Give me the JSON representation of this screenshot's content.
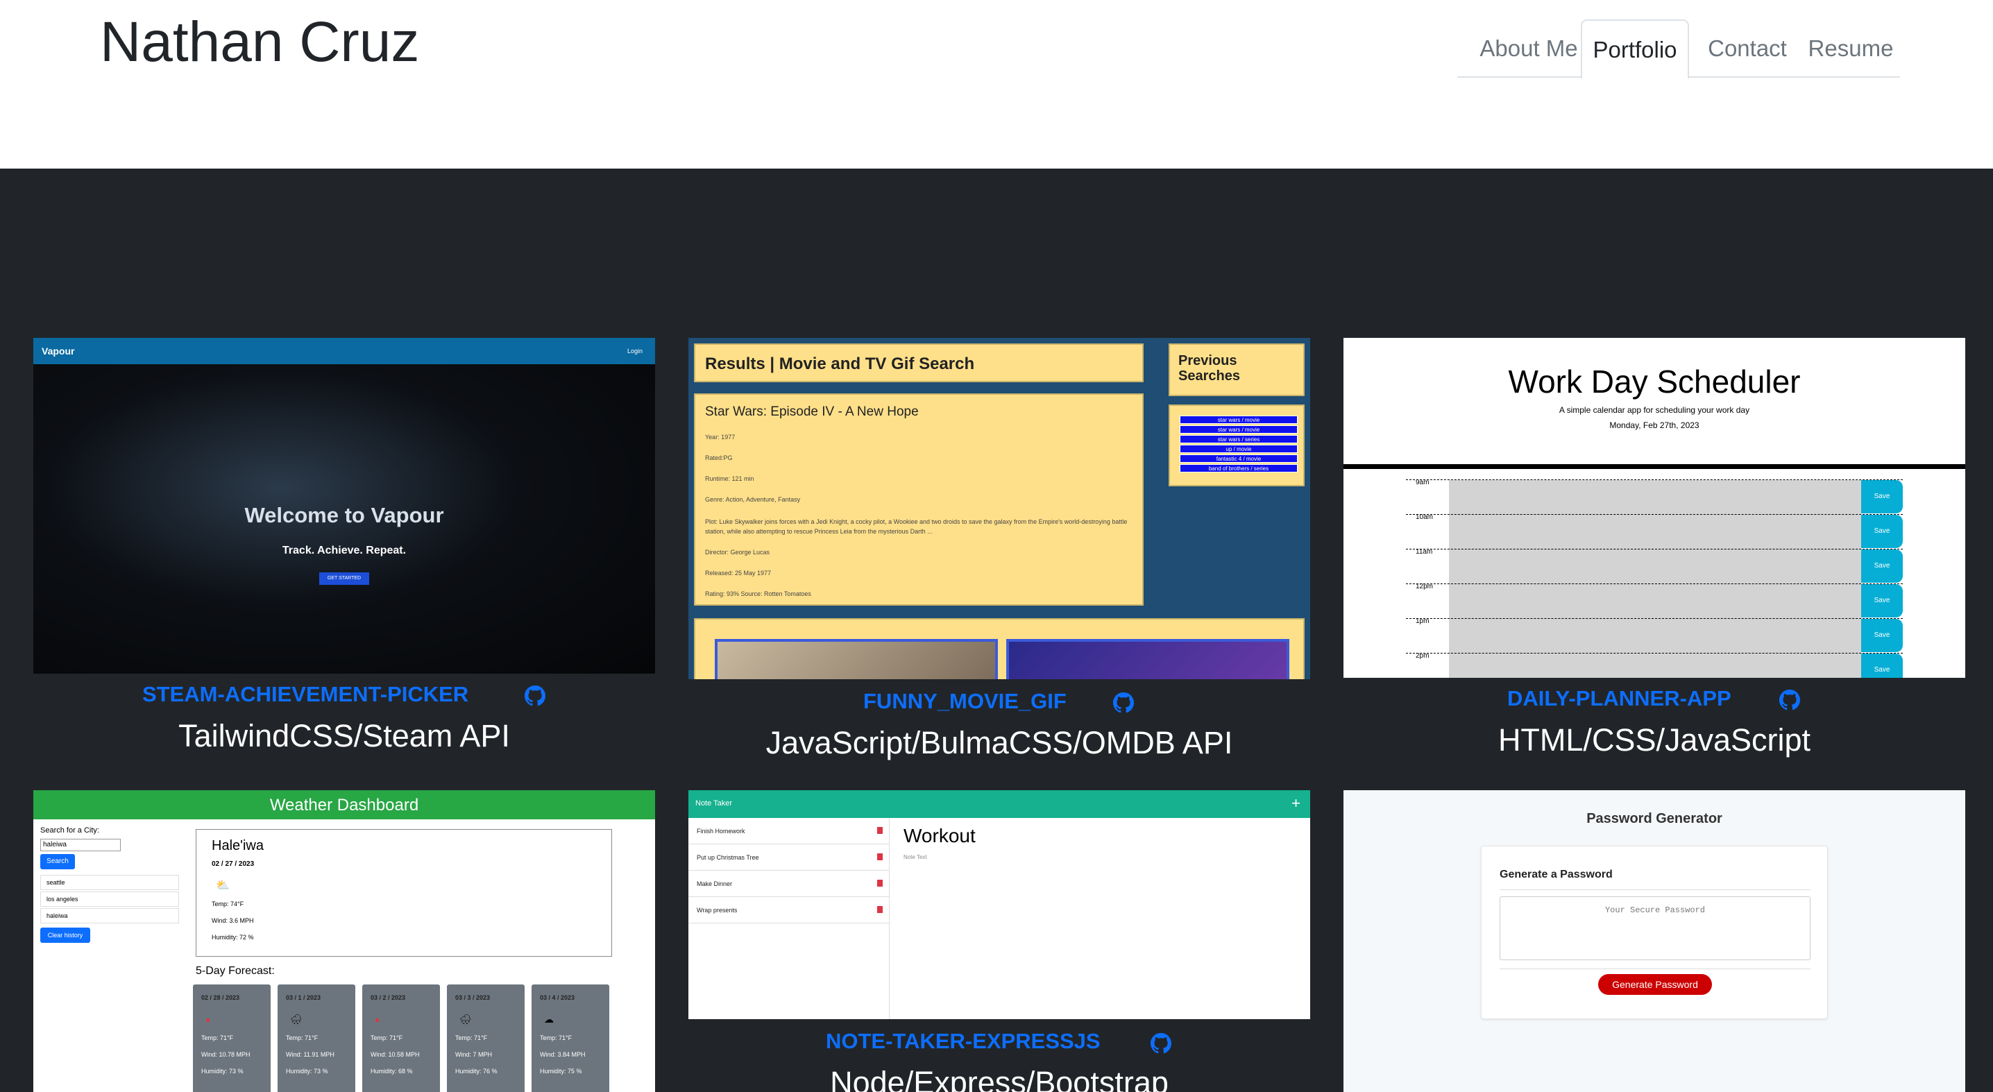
{
  "header": {
    "title": "Nathan Cruz"
  },
  "nav": [
    {
      "label": "About Me",
      "active": false
    },
    {
      "label": "Portfolio",
      "active": true
    },
    {
      "label": "Contact",
      "active": false
    },
    {
      "label": "Resume",
      "active": false
    }
  ],
  "projects": [
    {
      "name": "STEAM-ACHIEVEMENT-PICKER",
      "tech": "TailwindCSS/Steam API"
    },
    {
      "name": "FUNNY_MOVIE_GIF",
      "tech": "JavaScript/BulmaCSS/OMDB API"
    },
    {
      "name": "DAILY-PLANNER-APP",
      "tech": "HTML/CSS/JavaScript"
    },
    {
      "name": "NOTE-TAKER-EXPRESSJS",
      "tech": "Node/Express/Bootstrap"
    }
  ],
  "vapour": {
    "brand": "Vapour",
    "login": "Login",
    "welcome": "Welcome to Vapour",
    "tagline": "Track. Achieve. Repeat.",
    "cta": "GET STARTED"
  },
  "movie": {
    "title": "Results | Movie and TV Gif Search",
    "prev": "Previous Searches",
    "film": "Star Wars: Episode IV - A New Hope",
    "details": [
      "Year: 1977",
      "Rated:PG",
      "Runtime: 121 min",
      "Genre: Action, Adventure, Fantasy",
      "Plot: Luke Skywalker joins forces with a Jedi Knight, a cocky pilot, a Wookiee and two droids to save the galaxy from the Empire's world-destroying battle station, while also attempting to rescue Princess Leia from the mysterious Darth ...",
      "Director: George Lucas",
      "Released: 25 May 1977",
      "Rating: 93% Source: Rotten Tomatoes"
    ],
    "history": [
      "star wars / movie",
      "star wars / movie",
      "star wars / series",
      "up / movie",
      "fantastic 4 / movie",
      "band of brothers / series"
    ]
  },
  "planner": {
    "title": "Work Day Scheduler",
    "subtitle": "A simple calendar app for scheduling your work day",
    "date": "Monday, Feb 27th, 2023",
    "hours": [
      "9am",
      "10am",
      "11am",
      "12pm",
      "1pm",
      "2pm"
    ],
    "save": "Save"
  },
  "weather": {
    "title": "Weather Dashboard",
    "search_label": "Search for a City:",
    "search_value": "haleiwa",
    "search_btn": "Search",
    "history": [
      "seattle",
      "los angeles",
      "haleiwa"
    ],
    "clear": "Clear history",
    "city": "Hale'iwa",
    "date": "02 / 27 / 2023",
    "temp": "Temp: 74°F",
    "wind": "Wind: 3.6 MPH",
    "humidity": "Humidity: 72 %",
    "forecast_label": "5-Day Forecast:",
    "forecast": [
      {
        "date": "02 / 28 / 2023",
        "temp": "Temp: 71°F",
        "wind": "Wind: 10.78 MPH",
        "hum": "Humidity: 73 %"
      },
      {
        "date": "03 / 1 / 2023",
        "temp": "Temp: 71°F",
        "wind": "Wind: 11.91 MPH",
        "hum": "Humidity: 73 %"
      },
      {
        "date": "03 / 2 / 2023",
        "temp": "Temp: 71°F",
        "wind": "Wind: 10.58 MPH",
        "hum": "Humidity: 68 %"
      },
      {
        "date": "03 / 3 / 2023",
        "temp": "Temp: 71°F",
        "wind": "Wind: 7 MPH",
        "hum": "Humidity: 76 %"
      },
      {
        "date": "03 / 4 / 2023",
        "temp": "Temp: 71°F",
        "wind": "Wind: 3.84 MPH",
        "hum": "Humidity: 75 %"
      }
    ]
  },
  "notes": {
    "title": "Note Taker",
    "items": [
      "Finish Homework",
      "Put up Christmas Tree",
      "Make Dinner",
      "Wrap presents"
    ],
    "heading": "Workout",
    "text": "Note Text"
  },
  "password": {
    "title": "Password Generator",
    "card_title": "Generate a Password",
    "placeholder": "Your Secure Password",
    "btn": "Generate Password"
  }
}
